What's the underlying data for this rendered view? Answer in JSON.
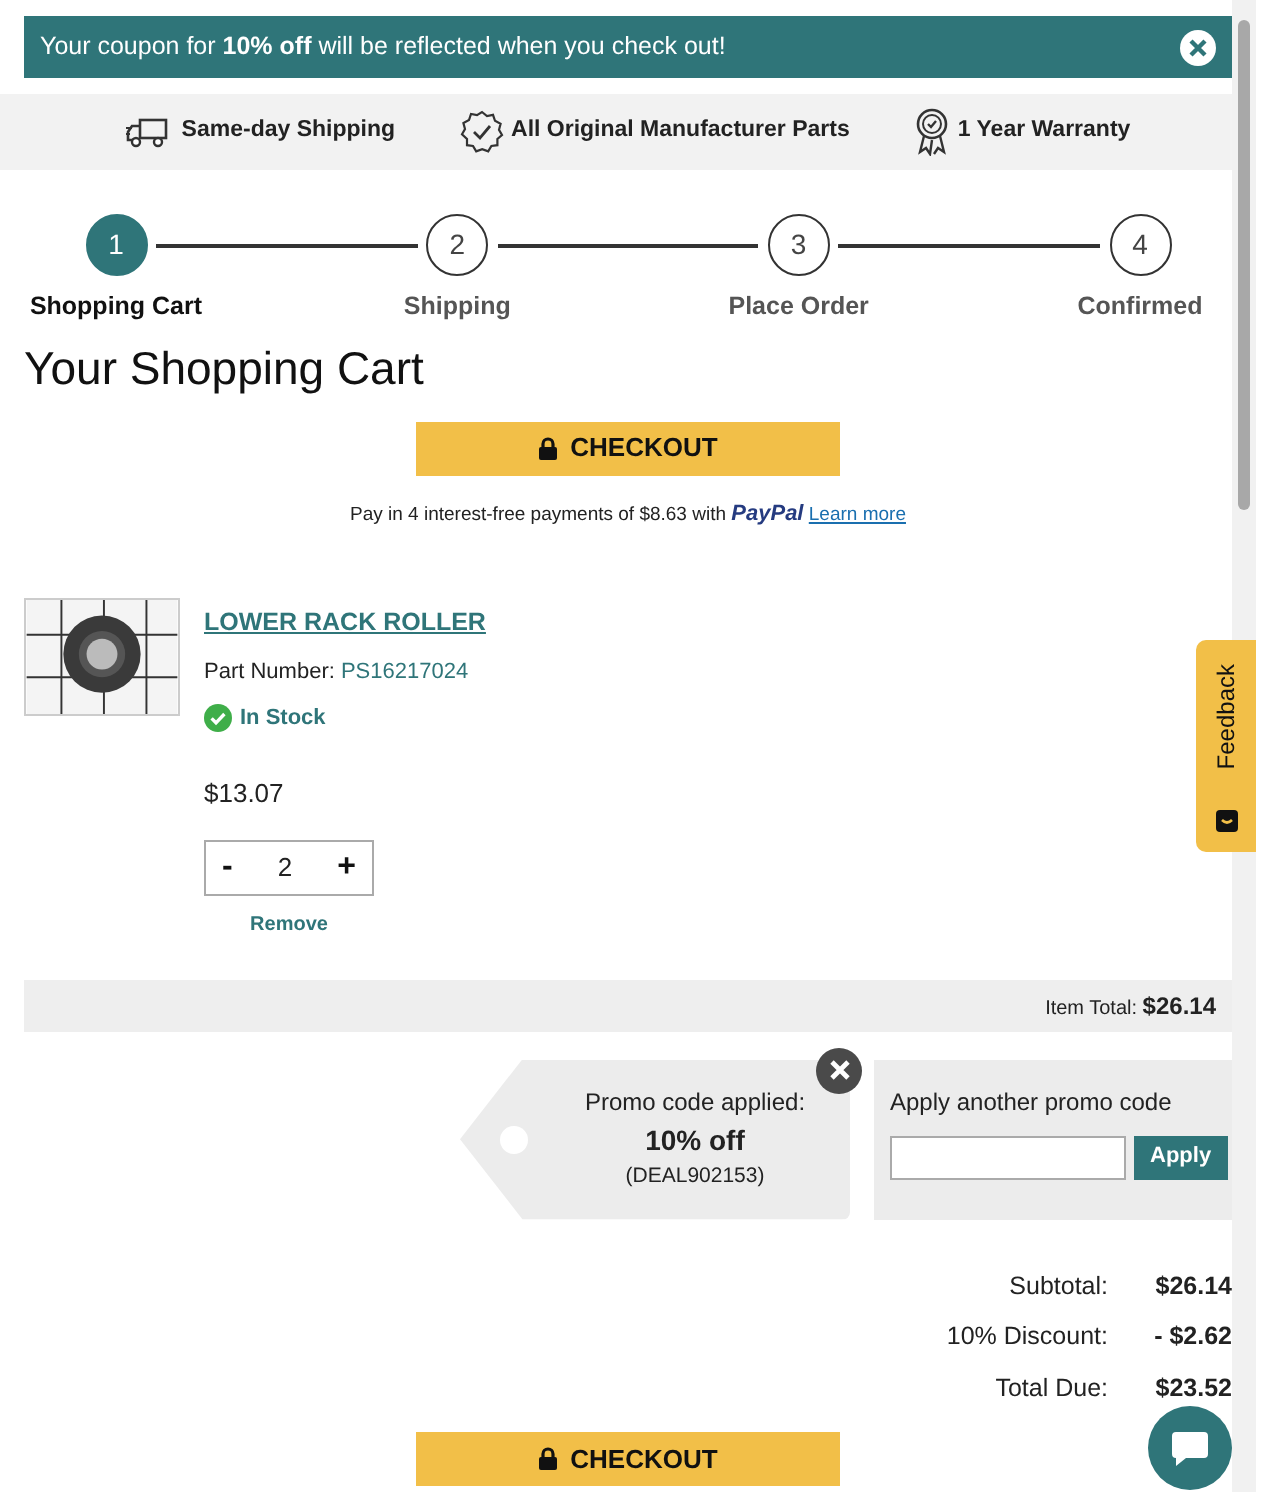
{
  "banner": {
    "text": "Your coupon for **10% off** will be reflected when you check out!"
  },
  "trust_bar": [
    {
      "label": "Same-day Shipping"
    },
    {
      "label": "All Original Manufacturer Parts"
    },
    {
      "label": "1 Year Warranty"
    }
  ],
  "steps": [
    {
      "number": "1",
      "label": "Shopping Cart",
      "selected": true
    },
    {
      "number": "2",
      "label": "Shipping",
      "selected": false
    },
    {
      "number": "3",
      "label": "Place Order",
      "selected": false
    },
    {
      "number": "4",
      "label": "Confirmed",
      "selected": false
    }
  ],
  "title": "Your Shopping Cart",
  "checkout_button": "CHECKOUT",
  "paypal": {
    "text": "Pay in 4 interest-free payments of $8.63 with",
    "brand": "PayPal",
    "link": "Learn more"
  },
  "item": {
    "name": "LOWER RACK ROLLER",
    "part_label": "Part Number:",
    "part_number": "PS16217024",
    "stock": "In Stock",
    "price": "$13.07",
    "quantity": "2",
    "minus": "-",
    "plus": "+",
    "remove": "Remove"
  },
  "item_total": {
    "label": "Item Total:",
    "value": "$26.14"
  },
  "promo": {
    "label": "Promo code applied:",
    "discount": "10% off",
    "code": "(DEAL902153)"
  },
  "promo_entry": {
    "label": "Apply another promo code",
    "button": "Apply"
  },
  "totals": [
    {
      "label": "Subtotal:",
      "value": "$26.14"
    },
    {
      "label": "10% Discount:",
      "value": "- $2.62"
    },
    {
      "label": "Total Due:",
      "value": "$23.52"
    }
  ],
  "bottom_checkout_button": "CHECKOUT",
  "feedback": "Feedback"
}
